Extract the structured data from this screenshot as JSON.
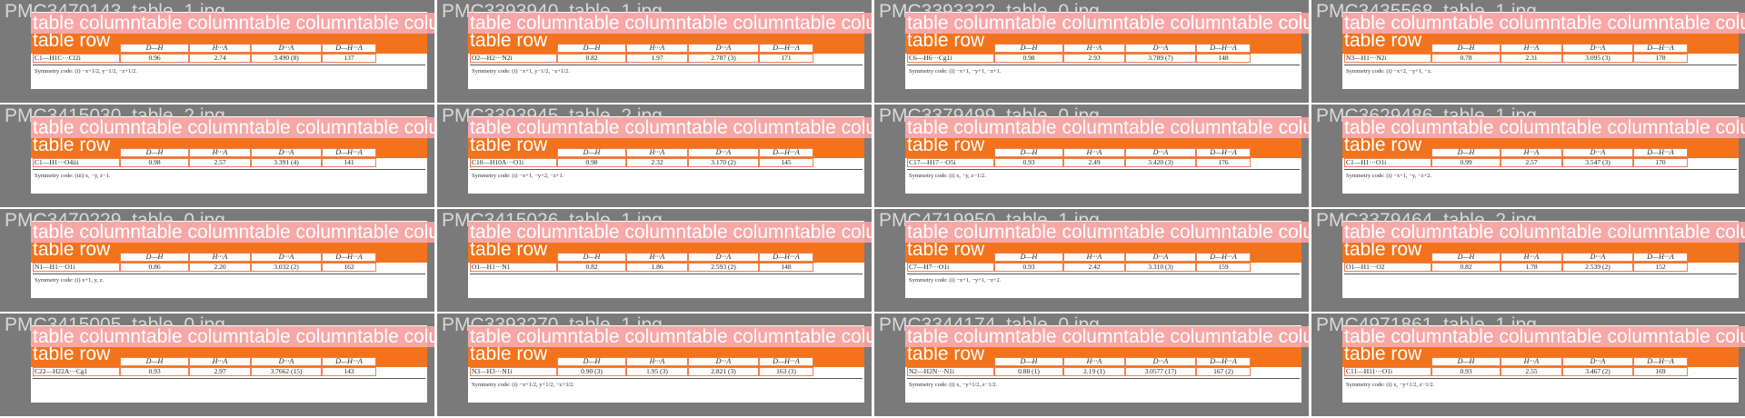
{
  "labels": {
    "column": "table column",
    "row": "table row"
  },
  "headers": [
    "",
    "D—H",
    "H···A",
    "D···A",
    "D—H···A"
  ],
  "tiles": [
    {
      "title": "PMC3470143_table_1.jpg",
      "row": [
        "C1—H1C···Cl2i",
        "0.96",
        "2.74",
        "3.490 (8)",
        "137"
      ],
      "symmetry": "Symmetry code: (i) −x+1/2, y−1/2, −z+1/2."
    },
    {
      "title": "PMC3393940_table_1.jpg",
      "row": [
        "O2—H2···N2i",
        "0.82",
        "1.97",
        "2.787 (3)",
        "171"
      ],
      "symmetry": "Symmetry code: (i) −x+1, y−1/2, −z+1/2."
    },
    {
      "title": "PMC3393322_table_0.jpg",
      "row": [
        "C6—H6···Cg1i",
        "0.98",
        "2.93",
        "3.789 (7)",
        "148"
      ],
      "symmetry": "Symmetry code: (i) −x+1, −y+1, −z+1."
    },
    {
      "title": "PMC3435568_table_1.jpg",
      "row": [
        "N3—H1···N2i",
        "0.78",
        "2.31",
        "3.095 (3)",
        "178"
      ],
      "symmetry": "Symmetry code: (i) −x+2, −y+1, −z."
    },
    {
      "title": "PMC3415030_table_2.jpg",
      "row": [
        "C1—H1···O4iii",
        "0.98",
        "2.57",
        "3.391 (4)",
        "141"
      ],
      "symmetry": "Symmetry code: (iii) x, −y, z−1."
    },
    {
      "title": "PMC3393945_table_2.jpg",
      "row": [
        "C10—H10A···O1i",
        "0.98",
        "2.32",
        "3.170 (2)",
        "145"
      ],
      "symmetry": "Symmetry code: (i) −x+1, −y+2, −z+1."
    },
    {
      "title": "PMC3379499_table_0.jpg",
      "row": [
        "C17—H17···O5i",
        "0.93",
        "2.49",
        "3.420 (3)",
        "176"
      ],
      "symmetry": "Symmetry code: (i) x, −y, z−1/2."
    },
    {
      "title": "PMC3629486_table_1.jpg",
      "row": [
        "C1—H1···O1i",
        "0.99",
        "2.57",
        "3.547 (3)",
        "170"
      ],
      "symmetry": "Symmetry code: (i) −x+1, −y, −z+2."
    },
    {
      "title": "PMC3470229_table_0.jpg",
      "row": [
        "N1—H1···O1i",
        "0.86",
        "2.20",
        "3.032 (2)",
        "162"
      ],
      "symmetry": "Symmetry code: (i) x+1, y, z."
    },
    {
      "title": "PMC3415026_table_1.jpg",
      "row": [
        "O1—H1···N1",
        "0.82",
        "1.86",
        "2.593 (2)",
        "148"
      ],
      "symmetry": ""
    },
    {
      "title": "PMC4719950_table_1.jpg",
      "row": [
        "C7—H7···O1i",
        "0.93",
        "2.42",
        "3.310 (3)",
        "159"
      ],
      "symmetry": "Symmetry code: (i) −x+1, −y+1, −z+2."
    },
    {
      "title": "PMC3379464_table_2.jpg",
      "row": [
        "O1—H1···O2",
        "0.82",
        "1.78",
        "2.539 (2)",
        "152"
      ],
      "symmetry": ""
    },
    {
      "title": "PMC3415005_table_0.jpg",
      "row": [
        "C22—H22A···Cg1",
        "0.93",
        "2.97",
        "3.7662 (15)",
        "143"
      ],
      "symmetry": ""
    },
    {
      "title": "PMC3393270_table_1.jpg",
      "row": [
        "N3—H3···N1i",
        "0.90 (3)",
        "1.95 (3)",
        "2.821 (3)",
        "163 (3)"
      ],
      "symmetry": "Symmetry code: (i) −x+1/2, y+1/2, −z+3/2."
    },
    {
      "title": "PMC3344174_table_0.jpg",
      "row": [
        "N2—H2N···N1i",
        "0.88 (1)",
        "2.19 (1)",
        "3.0577 (17)",
        "167 (2)"
      ],
      "symmetry": "Symmetry code: (i) x, −y+1/2, z−1/2."
    },
    {
      "title": "PMC4971861_table_1.jpg",
      "row": [
        "C11—H11···O1i",
        "0.93",
        "2.55",
        "3.467 (2)",
        "169"
      ],
      "symmetry": "Symmetry code: (i) x, −y+1/2, z−1/2."
    }
  ]
}
